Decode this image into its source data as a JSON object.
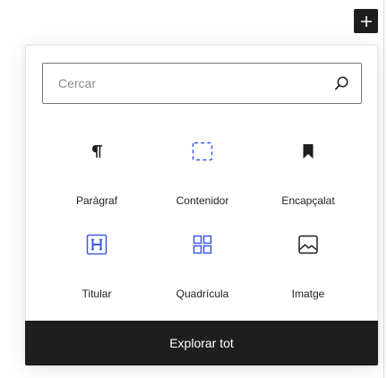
{
  "toolbar": {
    "add_block_icon": "plus-icon"
  },
  "inserter": {
    "search": {
      "placeholder": "Cercar",
      "value": "",
      "icon": "search-icon"
    },
    "blocks": [
      {
        "label": "Paràgraf",
        "icon": "paragraph-icon"
      },
      {
        "label": "Contenidor",
        "icon": "group-icon"
      },
      {
        "label": "Encapçalat",
        "icon": "bookmark-icon"
      },
      {
        "label": "Titular",
        "icon": "heading-icon"
      },
      {
        "label": "Quadrícula",
        "icon": "grid-icon"
      },
      {
        "label": "Imatge",
        "icon": "image-icon"
      }
    ],
    "browse_all_label": "Explorar tot"
  },
  "colors": {
    "dark": "#1e1e1e",
    "accent": "#3858e9",
    "border": "#757575"
  }
}
